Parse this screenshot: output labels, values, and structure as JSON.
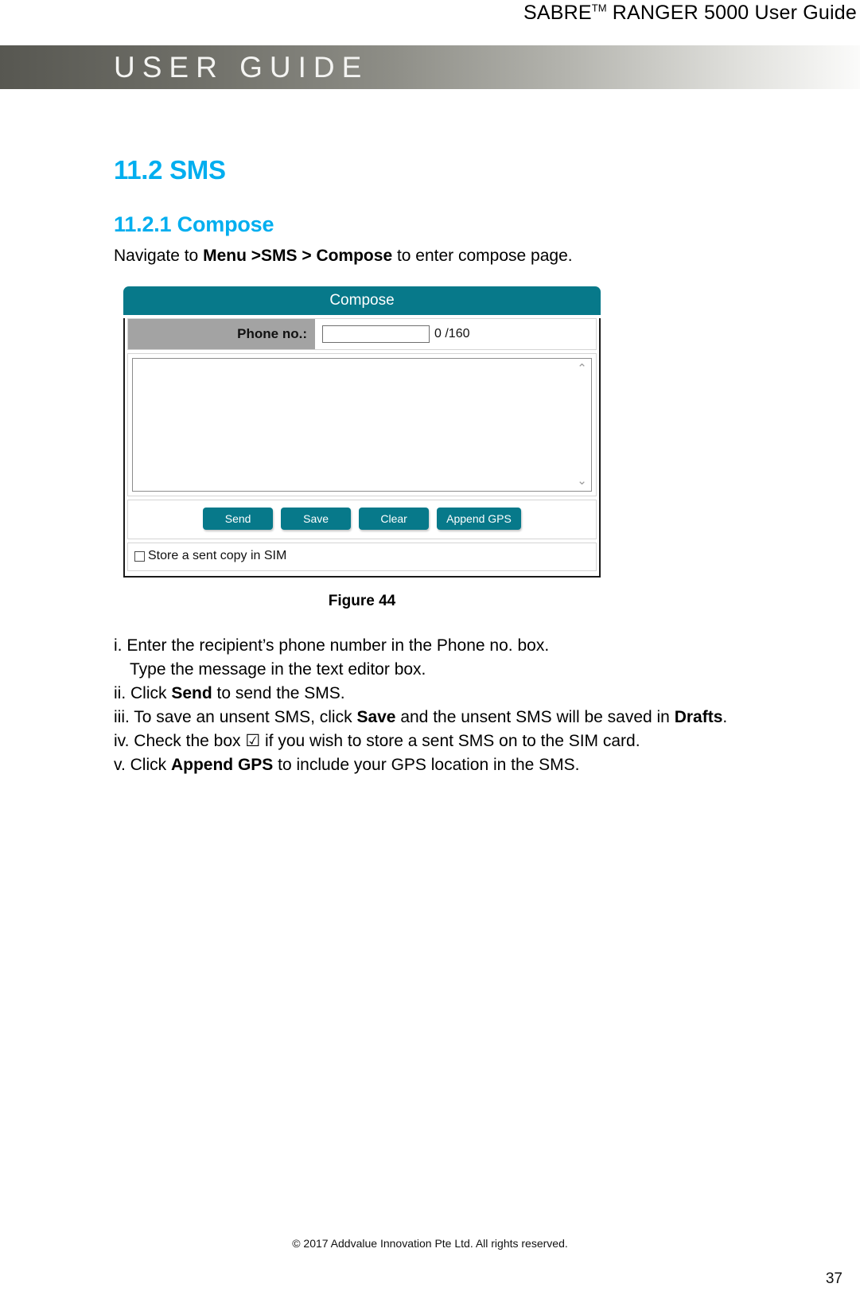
{
  "header": {
    "title_main": "SABRE",
    "title_tm": "TM",
    "title_rest": " RANGER 5000 User Guide",
    "banner_text": "USER GUIDE"
  },
  "section": {
    "number_title": "11.2 SMS",
    "sub_number_title": "11.2.1 Compose",
    "lead_prefix": "Navigate to ",
    "lead_bold": "Menu >SMS > Compose",
    "lead_suffix": " to enter compose page."
  },
  "compose": {
    "titlebar": "Compose",
    "phone_label": "Phone no.:",
    "phone_value": "",
    "phone_placeholder": "",
    "char_counter": "0 /160",
    "message_value": "",
    "message_placeholder": "",
    "scroll_up_icon": "⌃",
    "scroll_down_icon": "⌄",
    "buttons": [
      {
        "label": "Send",
        "name": "send-button"
      },
      {
        "label": "Save",
        "name": "save-button"
      },
      {
        "label": "Clear",
        "name": "clear-button"
      },
      {
        "label": "Append GPS",
        "name": "append-gps-button"
      }
    ],
    "store_copy_label": "Store a sent copy in SIM",
    "store_copy_checked": false,
    "accent_color": "#07798a",
    "label_bg_color": "#a3a3a3"
  },
  "figure": {
    "caption": "Figure 44"
  },
  "steps": [
    {
      "num": "i. ",
      "text_a": "Enter the recipient’s phone number in the Phone no. box.",
      "bold": "",
      "text_b": "",
      "indent": false
    },
    {
      "num": "",
      "text_a": "Type the message in the text editor box.",
      "bold": "",
      "text_b": "",
      "indent": true
    },
    {
      "num": "ii. ",
      "text_a": "Click ",
      "bold": "Send",
      "text_b": " to send the SMS.",
      "indent": false
    },
    {
      "num": "iii. ",
      "text_a": "To save an unsent SMS, click ",
      "bold": "Save",
      "text_b": " and the unsent SMS will be saved in ",
      "bold2": "Drafts",
      "text_c": ".",
      "indent": false
    },
    {
      "num": "iv. ",
      "text_a": "Check the box ☑ if you wish to store a sent SMS on to the SIM card.",
      "bold": "",
      "text_b": "",
      "indent": false
    },
    {
      "num": "v. ",
      "text_a": "Click ",
      "bold": "Append GPS",
      "text_b": " to include your GPS location in the SMS.",
      "indent": false
    }
  ],
  "footer": {
    "copyright": "© 2017 Addvalue Innovation Pte Ltd. All rights reserved.",
    "page_number": "37"
  },
  "theme": {
    "heading_color": "#00AEEF",
    "accent_teal": "#07798a"
  }
}
